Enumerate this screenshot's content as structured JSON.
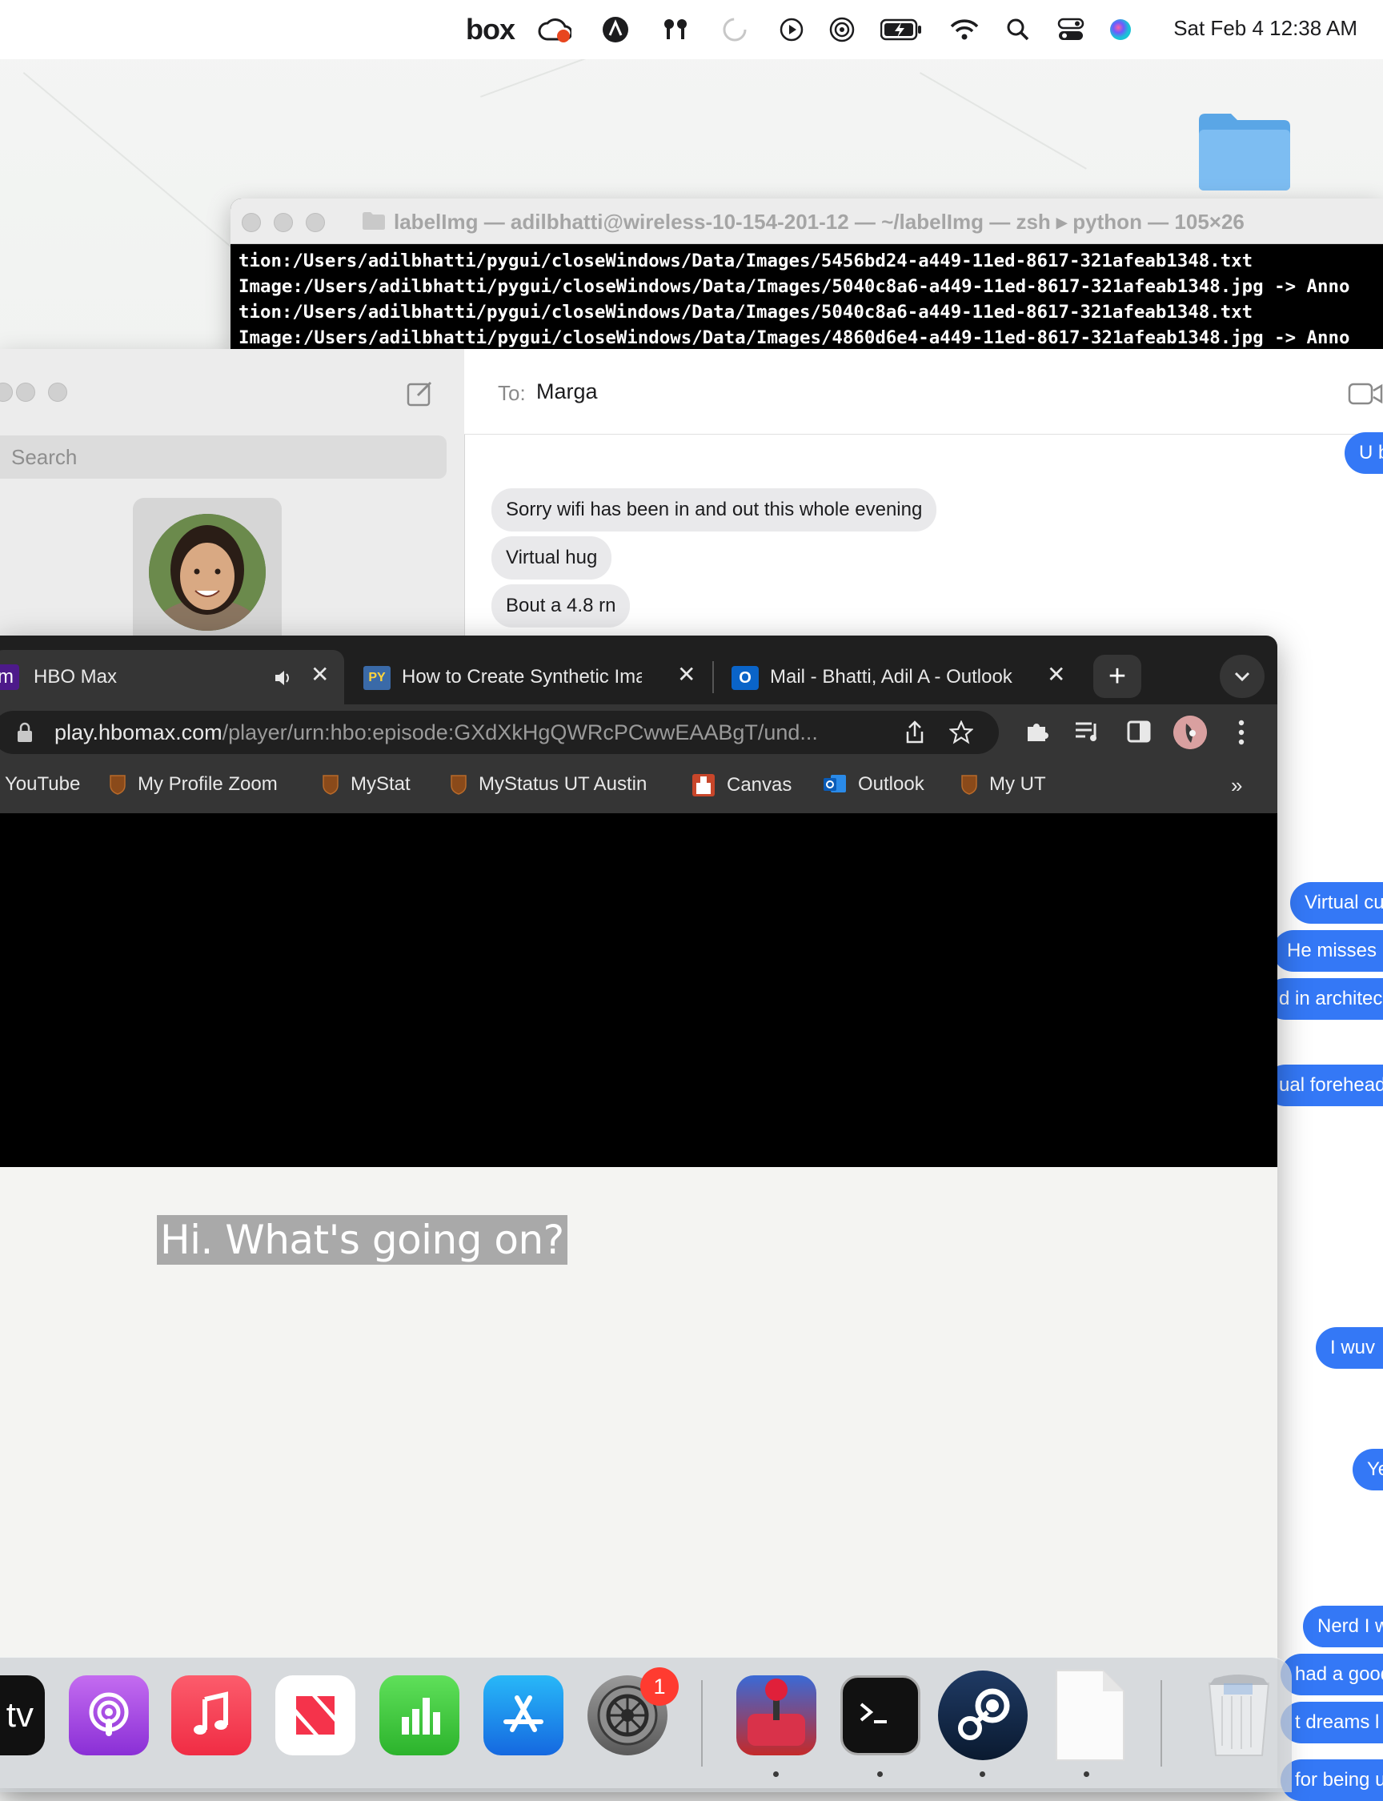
{
  "menubar": {
    "box_label": "box",
    "clock": "Sat Feb 4  12:38 AM"
  },
  "terminal": {
    "title": "labelImg — adilbhatti@wireless-10-154-201-12 — ~/labelImg — zsh ▸ python — 105×26",
    "lines": [
      "tion:/Users/adilbhatti/pygui/closeWindows/Data/Images/5456bd24-a449-11ed-8617-321afeab1348.txt",
      "Image:/Users/adilbhatti/pygui/closeWindows/Data/Images/5040c8a6-a449-11ed-8617-321afeab1348.jpg -> Anno",
      "tion:/Users/adilbhatti/pygui/closeWindows/Data/Images/5040c8a6-a449-11ed-8617-321afeab1348.txt",
      "Image:/Users/adilbhatti/pygui/closeWindows/Data/Images/4860d6e4-a449-11ed-8617-321afeab1348.jpg -> Anno"
    ]
  },
  "messages": {
    "search_placeholder": "Search",
    "to_label": "To:",
    "to_name": "Marga",
    "incoming": [
      "Sorry wifi has been in and out this whole evening",
      "Virtual hug",
      "Bout a 4.8 rn"
    ],
    "outgoing": [
      "U b",
      "Virtual cu",
      "He misses",
      "d in architec",
      "ual forehead",
      "I wuv",
      "Ye",
      "Nerd I w",
      "had a good",
      "t dreams l",
      "for being u"
    ]
  },
  "chrome": {
    "tabs": [
      {
        "favicon": "m",
        "label": "HBO Max"
      },
      {
        "favicon": "PY",
        "label": "How to Create Synthetic Imag"
      },
      {
        "favicon": "O",
        "label": "Mail - Bhatti, Adil A - Outlook"
      }
    ],
    "url_host": "play.hbomax.com",
    "url_path": "/player/urn:hbo:episode:GXdXkHgQWRcPCwwEAABgT/und...",
    "bookmarks": [
      "YouTube",
      "My Profile Zoom",
      "MyStat",
      "MyStatus UT Austin",
      "Canvas",
      "Outlook",
      "My UT"
    ],
    "bookmarks_overflow": "»",
    "subtitle": "Hi. What's going on?"
  },
  "dock": {
    "tv_label": "tv",
    "settings_badge": "1"
  },
  "colors": {
    "imessage_blue": "#3478f6",
    "chrome_dark": "#1f1f1f",
    "menubar": "#ffffff"
  }
}
